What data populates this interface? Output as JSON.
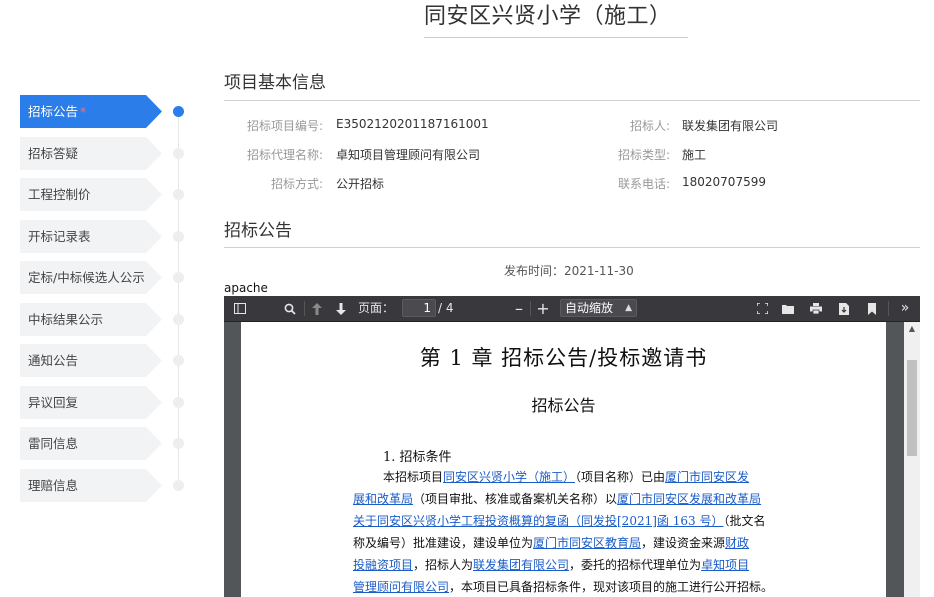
{
  "page_title": "同安区兴贤小学（施工）",
  "sidebar": {
    "items": [
      {
        "label": "招标公告",
        "required_mark": "*",
        "active": true
      },
      {
        "label": "招标答疑"
      },
      {
        "label": "工程控制价"
      },
      {
        "label": "开标记录表"
      },
      {
        "label": "定标/中标候选人公示"
      },
      {
        "label": "中标结果公示"
      },
      {
        "label": "通知公告"
      },
      {
        "label": "异议回复"
      },
      {
        "label": "雷同信息"
      },
      {
        "label": "理赔信息"
      }
    ]
  },
  "basic_info": {
    "title": "项目基本信息",
    "project_no_label": "招标项目编号:",
    "project_no": "E3502120201187161001",
    "tenderer_label": "招标人:",
    "tenderer": "联发集团有限公司",
    "agency_label": "招标代理名称:",
    "agency": "卓知项目管理顾问有限公司",
    "type_label": "招标类型:",
    "type": "施工",
    "method_label": "招标方式:",
    "method": "公开招标",
    "phone_label": "联系电话:",
    "phone": "18020707599"
  },
  "notice": {
    "title": "招标公告",
    "publish_label": "发布时间：",
    "publish_date": "2021-11-30"
  },
  "viewer": {
    "label": "apache",
    "page_label": "页面：",
    "page_current": "1",
    "page_total": "/ 4",
    "zoom": "自动缩放",
    "doc": {
      "chapter_title": "第 1 章 招标公告/投标邀请书",
      "sub_title": "招标公告",
      "section_head": "1. 招标条件",
      "l1_a": "本招标项目",
      "l1_b": "同安区兴贤小学（施工）",
      "l1_c": "（项目名称）已由",
      "l1_d": "厦门市同安区发",
      "l2_a": "展和改革局",
      "l2_b": "（项目审批、核准或备案机关名称）以",
      "l2_c": "厦门市同安区发展和改革局",
      "l3_a": "关于同安区兴贤小学工程投资概算的复函（同发投[2021]函 163 号）",
      "l3_b": "（批文名",
      "l4_a": "称及编号）批准建设，建设单位为",
      "l4_b": "厦门市同安区教育局",
      "l4_c": "，建设资金来源",
      "l4_d": "财政",
      "l5_a": "投融资项目",
      "l5_b": "，招标人为",
      "l5_c": "联发集团有限公司",
      "l5_d": "，委托的招标代理单位为",
      "l5_e": "卓知项目",
      "l6_a": "管理顾问有限公司",
      "l6_b": "，本项目已具备招标条件，现对该项目的施工进行公开招标。"
    }
  },
  "colors": {
    "accent": "#2b7de9",
    "link": "#1a5cc8",
    "toolbar_bg": "#38383d"
  }
}
